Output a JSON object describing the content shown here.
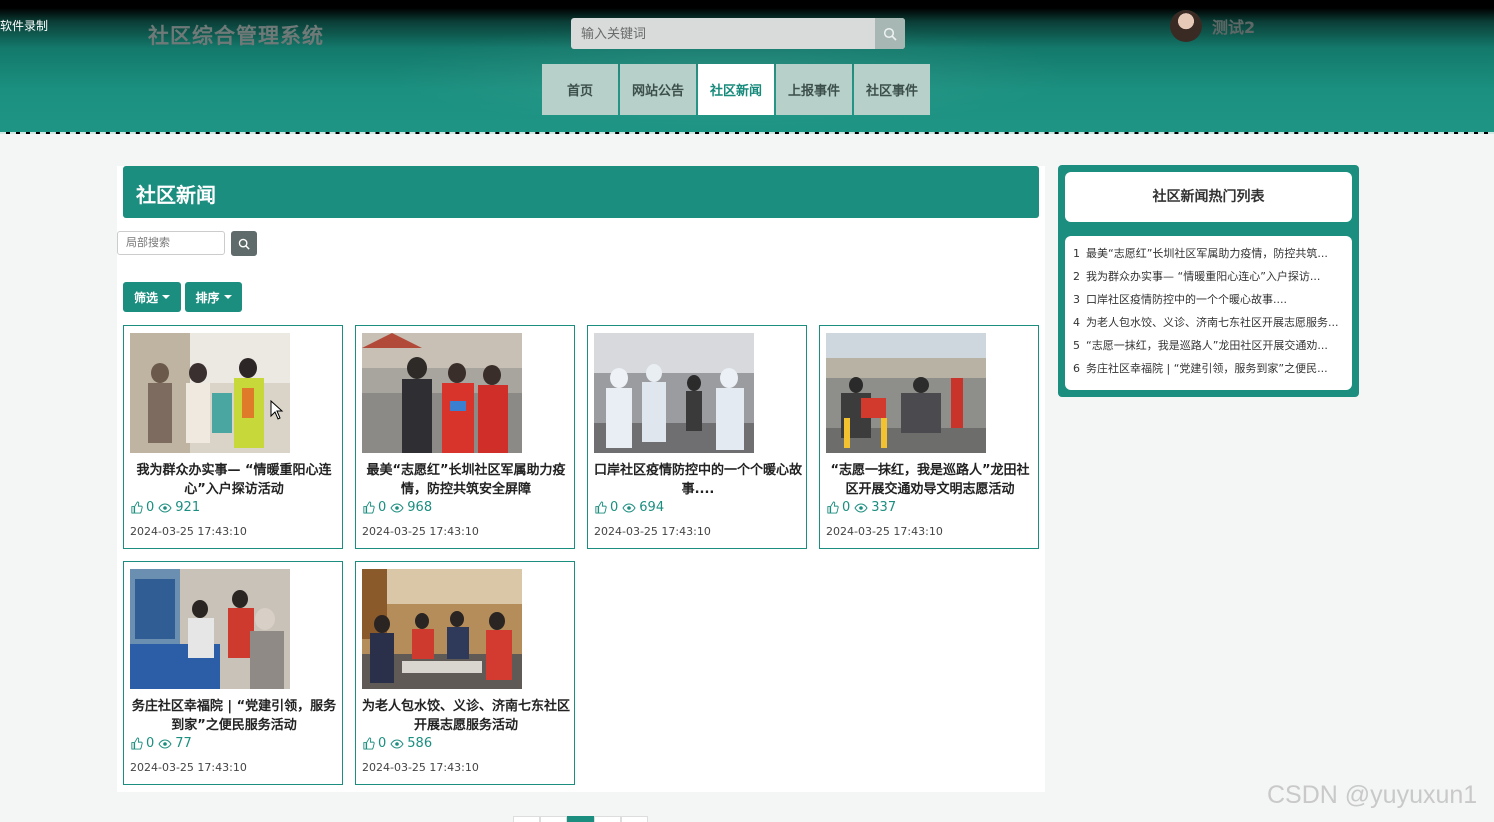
{
  "recorder_label": "软件录制",
  "header": {
    "site_title": "社区综合管理系统",
    "search_placeholder": "输入关键词",
    "username": "测试2"
  },
  "nav": {
    "items": [
      {
        "label": "首页"
      },
      {
        "label": "网站公告"
      },
      {
        "label": "社区新闻",
        "active": true
      },
      {
        "label": "上报事件"
      },
      {
        "label": "社区事件"
      }
    ]
  },
  "main": {
    "section_title": "社区新闻",
    "local_search_placeholder": "局部搜索",
    "filter_label": "筛选",
    "sort_label": "排序",
    "cards": [
      {
        "title": "我为群众办实事— “情暖重阳心连心”入户探访活动",
        "likes": "0",
        "views": "921",
        "date": "2024-03-25 17:43:10"
      },
      {
        "title": "最美“志愿红”长圳社区军属助力疫情，防控共筑安全屏障",
        "likes": "0",
        "views": "968",
        "date": "2024-03-25 17:43:10"
      },
      {
        "title": "口岸社区疫情防控中的一个个暖心故事....",
        "likes": "0",
        "views": "694",
        "date": "2024-03-25 17:43:10"
      },
      {
        "title": "“志愿一抹红，我是巡路人”龙田社区开展交通劝导文明志愿活动",
        "likes": "0",
        "views": "337",
        "date": "2024-03-25 17:43:10"
      },
      {
        "title": "务庄社区幸福院 | “党建引领，服务到家”之便民服务活动",
        "likes": "0",
        "views": "77",
        "date": "2024-03-25 17:43:10"
      },
      {
        "title": "为老人包水饺、义诊、济南七东社区开展志愿服务活动",
        "likes": "0",
        "views": "586",
        "date": "2024-03-25 17:43:10"
      }
    ]
  },
  "sidebar": {
    "title": "社区新闻热门列表",
    "items": [
      {
        "num": "1",
        "text": "最美“志愿红”长圳社区军属助力疫情，防控共筑..."
      },
      {
        "num": "2",
        "text": "我为群众办实事— “情暖重阳心连心”入户探访..."
      },
      {
        "num": "3",
        "text": "口岸社区疫情防控中的一个个暖心故事...."
      },
      {
        "num": "4",
        "text": "为老人包水饺、义诊、济南七东社区开展志愿服务..."
      },
      {
        "num": "5",
        "text": "“志愿一抹红，我是巡路人”龙田社区开展交通劝..."
      },
      {
        "num": "6",
        "text": "务庄社区幸福院 | “党建引领，服务到家”之便民..."
      }
    ]
  },
  "watermark": "CSDN @yuyuxun1",
  "colors": {
    "primary": "#1b8e7f",
    "nav_bg": "#b7d0c9"
  }
}
